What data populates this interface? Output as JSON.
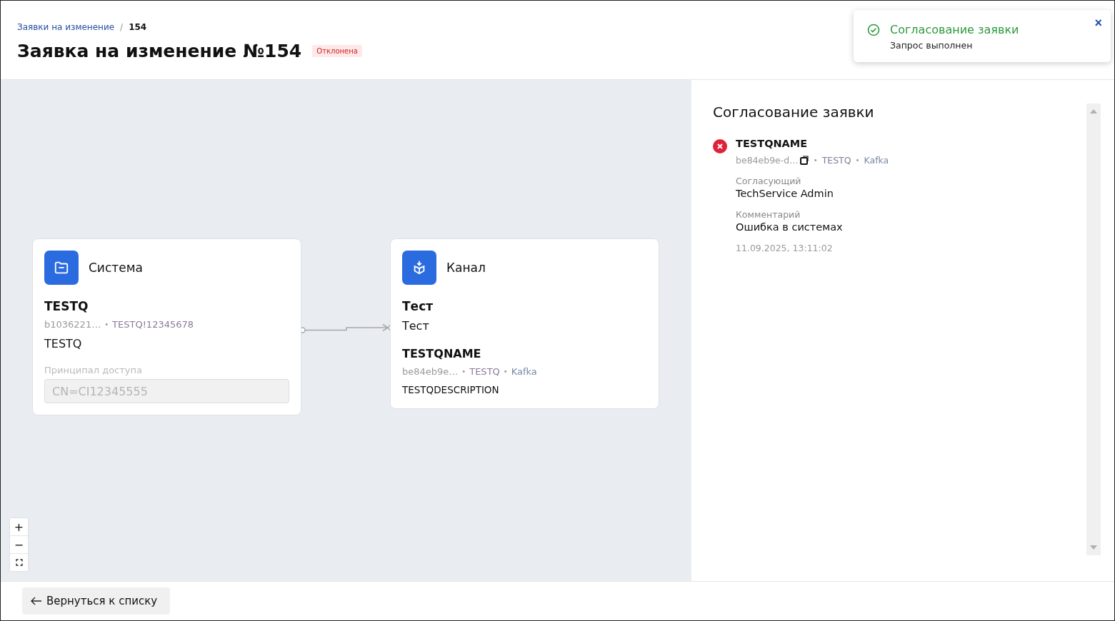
{
  "breadcrumbs": [
    {
      "label": "Заявки на изменение",
      "current": false
    },
    {
      "label": "154",
      "current": true
    }
  ],
  "breadcrumb_separator": "/",
  "meta_separator": "•",
  "title": "Заявка на изменение №154",
  "status": {
    "label": "Отклонена",
    "kind": "rejected"
  },
  "toast": {
    "kind": "success",
    "title": "Согласование заявки",
    "message": "Запрос выполнен",
    "close": "×"
  },
  "nodes": [
    {
      "kind": "system",
      "type_label": "Система",
      "name": "TESTQ",
      "meta": [
        "b1036221…",
        "TESTQ!12345678"
      ],
      "description": "TESTQ",
      "field": {
        "label": "Принципал доступа",
        "value": "CN=CI12345555",
        "disabled": true
      }
    },
    {
      "kind": "channel",
      "type_label": "Канал",
      "name": "Тест",
      "subtitle": "Тест",
      "item_name": "TESTQNAME",
      "meta": [
        "be84eb9e…",
        "TESTQ",
        "Kafka"
      ],
      "description": "TESTQDESCRIPTION"
    }
  ],
  "zoom_controls": [
    "+",
    "−"
  ],
  "approval": {
    "title": "Согласование заявки",
    "entries": [
      {
        "kind": "rejected",
        "name": "TESTQNAME",
        "id": "be84eb9e-d…",
        "meta": [
          "TESTQ",
          "Kafka"
        ],
        "approver_label": "Согласующий",
        "approver": "TechService Admin",
        "comment_label": "Комментарий",
        "comment": "Ошибка в системах",
        "timestamp": "11.09.2025, 13:11:02"
      }
    ]
  },
  "back_button": {
    "label": "Вернуться к списку"
  }
}
